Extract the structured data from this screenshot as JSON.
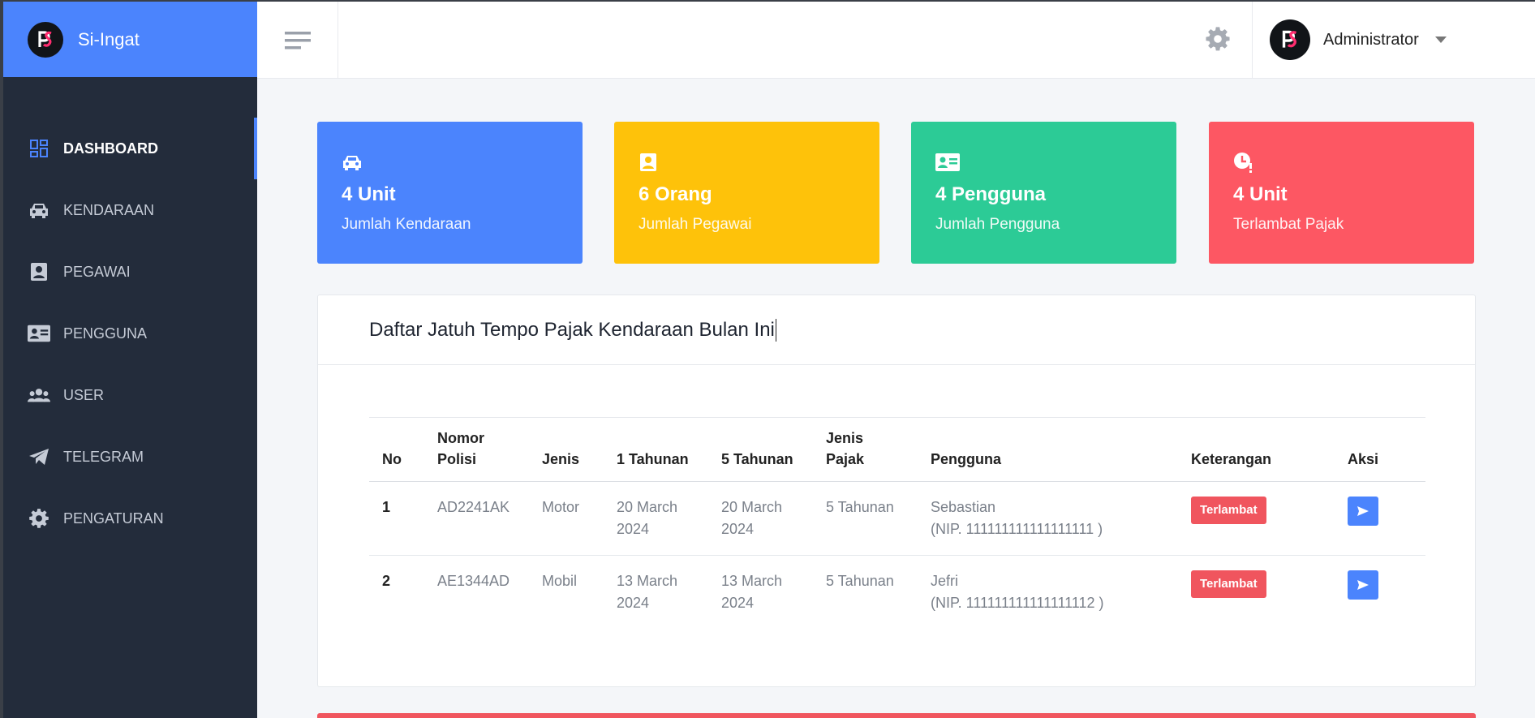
{
  "app": {
    "brand_name": "Si-Ingat"
  },
  "sidebar": {
    "items": [
      {
        "label": "DASHBOARD",
        "icon": "dashboard-icon",
        "active": true
      },
      {
        "label": "KENDARAAN",
        "icon": "car-icon"
      },
      {
        "label": "PEGAWAI",
        "icon": "id-badge-icon"
      },
      {
        "label": "PENGGUNA",
        "icon": "id-card-icon"
      },
      {
        "label": "USER",
        "icon": "users-icon"
      },
      {
        "label": "TELEGRAM",
        "icon": "telegram-icon"
      },
      {
        "label": "PENGATURAN",
        "icon": "gear-icon"
      }
    ]
  },
  "topbar": {
    "user_name": "Administrator"
  },
  "stats": [
    {
      "value": "4 Unit",
      "label": "Jumlah Kendaraan",
      "color": "#4b84fd",
      "icon": "car-icon"
    },
    {
      "value": "6 Orang",
      "label": "Jumlah Pegawai",
      "color": "#fec20a",
      "icon": "id-badge-icon"
    },
    {
      "value": "4 Pengguna",
      "label": "Jumlah Pengguna",
      "color": "#2ccb96",
      "icon": "id-card-icon"
    },
    {
      "value": "4 Unit",
      "label": "Terlambat Pajak",
      "color": "#fd5763",
      "icon": "clock-alert-icon"
    }
  ],
  "panel": {
    "title": "Daftar Jatuh Tempo Pajak Kendaraan Bulan Ini",
    "columns": [
      "No",
      "Nomor Polisi",
      "Jenis",
      "1 Tahunan",
      "5 Tahunan",
      "Jenis Pajak",
      "Pengguna",
      "Keterangan",
      "Aksi"
    ],
    "rows": [
      {
        "no": "1",
        "nopol": "AD2241AK",
        "jenis": "Motor",
        "tahunan1": "20 March 2024",
        "tahunan5": "20 March 2024",
        "jenis_pajak": "5 Tahunan",
        "pengguna_name": "Sebastian",
        "pengguna_nip": "(NIP. 111111111111111111 )",
        "keterangan": "Terlambat"
      },
      {
        "no": "2",
        "nopol": "AE1344AD",
        "jenis": "Mobil",
        "tahunan1": "13 March 2024",
        "tahunan5": "13 March 2024",
        "jenis_pajak": "5 Tahunan",
        "pengguna_name": "Jefri",
        "pengguna_nip": "(NIP. 111111111111111112 )",
        "keterangan": "Terlambat"
      }
    ]
  },
  "colors": {
    "primary": "#4b84fd",
    "danger": "#f0555e",
    "sidebar_bg": "#232c3b"
  }
}
